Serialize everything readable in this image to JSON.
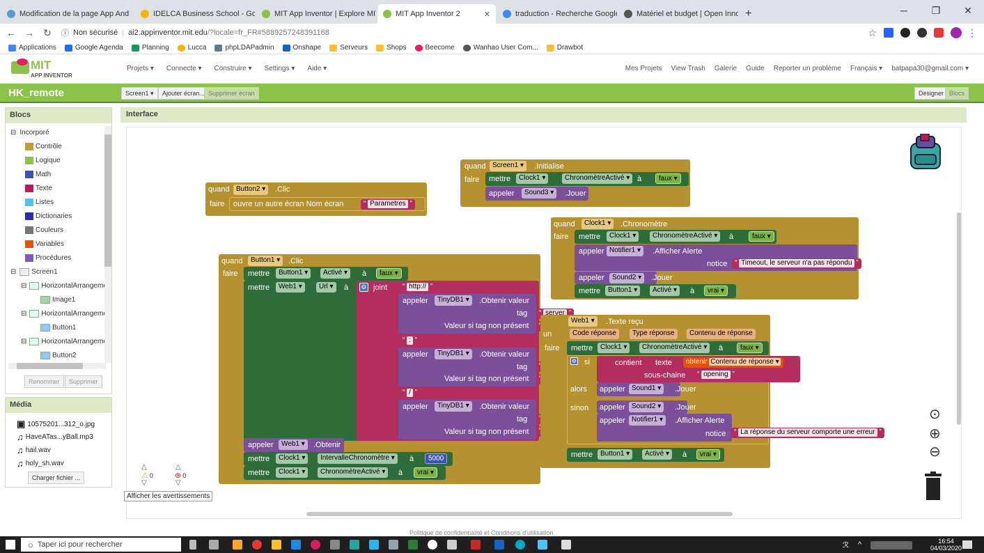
{
  "browser": {
    "tabs": [
      "Modification de la page App And",
      "IDELCA Business School - Google",
      "MIT App Inventor | Explore MIT A",
      "MIT App Inventor 2",
      "traduction - Recherche Google",
      "Matériel et budget | Open Innov"
    ],
    "url_security": "Non sécurisé",
    "url_host": "ai2.appinventor.mit.edu",
    "url_path": "/?locale=fr_FR#5889257248391168",
    "bookmarks": [
      "Applications",
      "Google Agenda",
      "Planning",
      "Lucca",
      "phpLDAPadmin",
      "Onshape",
      "Serveurs",
      "Shops",
      "Beecome",
      "Wanhao User Com...",
      "Drawbot"
    ],
    "colors": {
      "chrome": "#dee1e6",
      "accent": "#8bc34a"
    }
  },
  "app": {
    "logo_big": "MIT",
    "logo_small": "APP INVENTOR",
    "menu": [
      "Projets ▾",
      "Connecte ▾",
      "Construire ▾",
      "Settings ▾",
      "Aide ▾"
    ],
    "right_menu": [
      "Mes Projets",
      "View Trash",
      "Galerie",
      "Guide",
      "Reporter un problème",
      "Français ▾",
      "batpapa30@gmail.com ▾"
    ],
    "project_name": "HK_remote",
    "screen_select": "Screen1 ▾",
    "add_screen": "Ajouter écran...",
    "remove_screen": "Supprimer écran",
    "designer": "Designer",
    "blocs": "Blocs"
  },
  "blocs_panel": {
    "title": "Blocs",
    "builtin": "Incorporé",
    "builtin_items": [
      {
        "label": "Contrôle",
        "color": "#c39b2e"
      },
      {
        "label": "Logique",
        "color": "#8bc34a"
      },
      {
        "label": "Math",
        "color": "#3f51b5"
      },
      {
        "label": "Texte",
        "color": "#c2185b"
      },
      {
        "label": "Listes",
        "color": "#4fc3f7"
      },
      {
        "label": "Dictionaries",
        "color": "#2b2bb0"
      },
      {
        "label": "Couleurs",
        "color": "#757575"
      },
      {
        "label": "Variables",
        "color": "#e65100"
      },
      {
        "label": "Procédures",
        "color": "#7e57c2"
      }
    ],
    "screen": "Screen1",
    "components": [
      "HorizontalArrangemen",
      "Image1",
      "HorizontalArrangemen",
      "Button1",
      "HorizontalArrangemen",
      "Button2"
    ],
    "rename": "Renommer",
    "delete": "Supprimer"
  },
  "media_panel": {
    "title": "Média",
    "items": [
      "10575201...312_o.jpg",
      "HaveATas...yBall.mp3",
      "hail.wav",
      "holy_sh.wav"
    ],
    "upload": "Charger fichier ..."
  },
  "workspace": {
    "title": "Interface",
    "warnings_count": "0",
    "errors_count": "0",
    "show_warnings": "Afficher les avertissements"
  },
  "blocks": {
    "b2_when": "quand",
    "b2_comp": "Button2 ▾",
    "b2_event": ".Clic",
    "b2_do": "faire",
    "b2_open": "ouvre un autre écran  Nom écran",
    "b2_param": "Parametres",
    "s1_when": "quand",
    "s1_comp": "Screen1 ▾",
    "s1_event": ".Initialise",
    "s1_do": "faire",
    "s1_set": "mettre",
    "s1_clock": "Clock1 ▾",
    "s1_prop": "ChronomètreActivé ▾",
    "s1_to": "à",
    "s1_false": "faux ▾",
    "s1_call": "appeler",
    "s1_sound": "Sound3 ▾",
    "s1_play": ".Jouer",
    "c1_when": "quand",
    "c1_comp": "Clock1 ▾",
    "c1_event": ".Chronomètre",
    "c1_do": "faire",
    "c1_set": "mettre",
    "c1_clock": "Clock1 ▾",
    "c1_prop": "ChronomètreActivé ▾",
    "c1_to": "à",
    "c1_false": "faux ▾",
    "c1_call": "appeler",
    "c1_notif": "Notifier1 ▾",
    "c1_alert": ".Afficher Alerte",
    "c1_notice": "notice",
    "c1_msg": "Timeout, le serveur n'a pas répondu",
    "c1_call2": "appeler",
    "c1_sound": "Sound2 ▾",
    "c1_play": ".Jouer",
    "c1_set2": "mettre",
    "c1_btn": "Button1 ▾",
    "c1_enabled": "Activé ▾",
    "c1_to2": "à",
    "c1_true": "vrai ▾",
    "b1_when": "quand",
    "b1_comp": "Button1 ▾",
    "b1_event": ".Clic",
    "b1_do": "faire",
    "b1_set1": "mettre",
    "b1_btn": "Button1 ▾",
    "b1_enabled": "Activé ▾",
    "b1_to1": "à",
    "b1_false": "faux ▾",
    "b1_set2": "mettre",
    "b1_web": "Web1 ▾",
    "b1_url": "Url ▾",
    "b1_to2": "à",
    "b1_join": "joint",
    "b1_http": "http://",
    "b1_call1": "appeler",
    "b1_db1": "TinyDB1 ▾",
    "b1_get1": ".Obtenir valeur",
    "b1_tag1": "tag",
    "b1_server": "server",
    "b1_default1": "Valeur si tag non présent",
    "b1_empty": "",
    "b1_colon": ":",
    "b1_call2": "appeler",
    "b1_db2": "TinyDB1 ▾",
    "b1_get2": ".Obtenir valeur",
    "b1_tag2": "tag",
    "b1_port": "port",
    "b1_default2": "Valeur si tag non présent",
    "b1_80": "80",
    "b1_slash": "/",
    "b1_call3": "appeler",
    "b1_db3": "TinyDB1 ▾",
    "b1_get3": ".Obtenir valeur",
    "b1_tag3": "tag",
    "b1_pass": "pass",
    "b1_default3": "Valeur si tag non présent",
    "b1_open": "open",
    "b1_call4": "appeler",
    "b1_web2": "Web1 ▾",
    "b1_fetch": ".Obtenir",
    "b1_set3": "mettre",
    "b1_clock1": "Clock1 ▾",
    "b1_interval": "IntervalleChronomètre ▾",
    "b1_to3": "à",
    "b1_5000": "5000",
    "b1_set4": "mettre",
    "b1_clock2": "Clock1 ▾",
    "b1_timeron": "ChronomètreActivé ▾",
    "b1_to4": "à",
    "b1_true": "vrai ▾",
    "w1_comp": "Web1 ▾",
    "w1_event": ".Texte reçu",
    "w1_un": "un",
    "w1_p1": "Code réponse",
    "w1_p2": "Type réponse",
    "w1_p3": "Contenu de réponse",
    "w1_do": "faire",
    "w1_set": "mettre",
    "w1_clock": "Clock1 ▾",
    "w1_prop": "ChronomètreActivé ▾",
    "w1_to": "à",
    "w1_false": "faux ▾",
    "w1_if": "si",
    "w1_contains": "contient",
    "w1_text": "texte",
    "w1_get": "obtenir",
    "w1_getvar": "Contenu de réponse ▾",
    "w1_sub": "sous-chaine",
    "w1_opening": "opening",
    "w1_then": "alors",
    "w1_call1": "appeler",
    "w1_sound1": "Sound1 ▾",
    "w1_play1": ".Jouer",
    "w1_else": "sinon",
    "w1_call2": "appeler",
    "w1_sound2": "Sound2 ▾",
    "w1_play2": ".Jouer",
    "w1_call3": "appeler",
    "w1_notif": "Notifier1 ▾",
    "w1_alert": ".Afficher Alerte",
    "w1_notice": "notice",
    "w1_err": "La réponse du serveur comporte une erreur",
    "w1_set2": "mettre",
    "w1_btn": "Button1 ▾",
    "w1_enabled": "Activé ▾",
    "w1_to2": "à",
    "w1_true": "vrai ▾"
  },
  "footer": "Politique de confidentialité et Conditions d'utilisation",
  "taskbar": {
    "search": "Taper ici pour rechercher",
    "time": "16:54",
    "date": "04/03/2020"
  }
}
